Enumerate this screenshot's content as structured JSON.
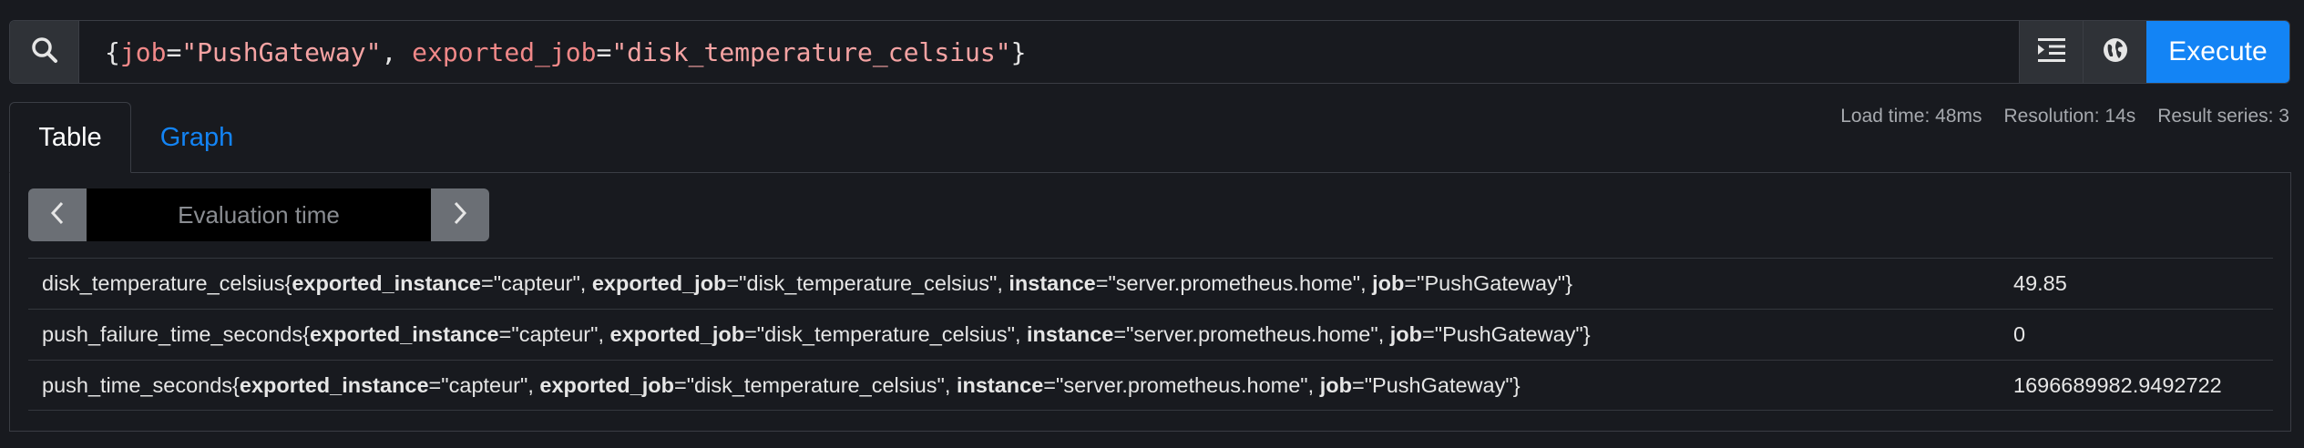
{
  "query": {
    "tokens": [
      {
        "t": "{",
        "c": "punct"
      },
      {
        "t": "job",
        "c": "label"
      },
      {
        "t": "=",
        "c": "punct"
      },
      {
        "t": "\"PushGateway\"",
        "c": "str"
      },
      {
        "t": ", ",
        "c": "punct"
      },
      {
        "t": "exported_job",
        "c": "label"
      },
      {
        "t": "=",
        "c": "punct"
      },
      {
        "t": "\"disk_temperature_celsius\"",
        "c": "str"
      },
      {
        "t": "}",
        "c": "punct"
      }
    ]
  },
  "toolbar": {
    "search_icon": "search-icon",
    "format_icon": "indent-icon",
    "explore_icon": "globe-icon",
    "execute_label": "Execute"
  },
  "tabs": [
    {
      "label": "Table",
      "active": true
    },
    {
      "label": "Graph",
      "active": false
    }
  ],
  "stats": {
    "load_time": "Load time: 48ms",
    "resolution": "Resolution: 14s",
    "result_series": "Result series: 3"
  },
  "eval": {
    "placeholder": "Evaluation time"
  },
  "results": [
    {
      "metric": "disk_temperature_celsius",
      "labels": [
        {
          "k": "exported_instance",
          "v": "\"capteur\""
        },
        {
          "k": "exported_job",
          "v": "\"disk_temperature_celsius\""
        },
        {
          "k": "instance",
          "v": "\"server.prometheus.home\""
        },
        {
          "k": "job",
          "v": "\"PushGateway\""
        }
      ],
      "value": "49.85"
    },
    {
      "metric": "push_failure_time_seconds",
      "labels": [
        {
          "k": "exported_instance",
          "v": "\"capteur\""
        },
        {
          "k": "exported_job",
          "v": "\"disk_temperature_celsius\""
        },
        {
          "k": "instance",
          "v": "\"server.prometheus.home\""
        },
        {
          "k": "job",
          "v": "\"PushGateway\""
        }
      ],
      "value": "0"
    },
    {
      "metric": "push_time_seconds",
      "labels": [
        {
          "k": "exported_instance",
          "v": "\"capteur\""
        },
        {
          "k": "exported_job",
          "v": "\"disk_temperature_celsius\""
        },
        {
          "k": "instance",
          "v": "\"server.prometheus.home\""
        },
        {
          "k": "job",
          "v": "\"PushGateway\""
        }
      ],
      "value": "1696689982.9492722"
    }
  ],
  "colors": {
    "accent": "#1384f5",
    "background": "#181a1f",
    "button": "#2f3237"
  }
}
